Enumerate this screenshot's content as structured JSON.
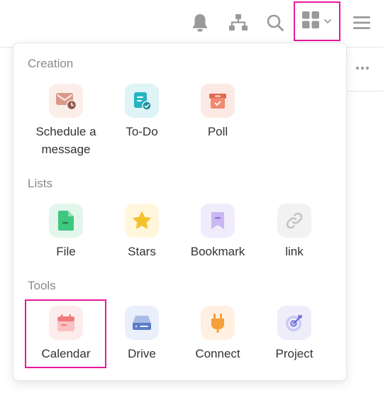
{
  "topbar": {
    "icons": [
      "bell-icon",
      "org-chart-icon",
      "search-icon",
      "apps-grid-icon",
      "chevron-down-icon",
      "hamburger-menu-icon"
    ]
  },
  "menu": {
    "sections": [
      {
        "title": "Creation",
        "items": [
          {
            "label": "Schedule a message",
            "icon": "schedule-message-icon",
            "bg": "#fbeee9",
            "color": "#d99a8a"
          },
          {
            "label": "To-Do",
            "icon": "todo-icon",
            "bg": "#def4f6",
            "color": "#27b3c1"
          },
          {
            "label": "Poll",
            "icon": "poll-icon",
            "bg": "#fde9e3",
            "color": "#f08a6e"
          }
        ]
      },
      {
        "title": "Lists",
        "items": [
          {
            "label": "File",
            "icon": "file-icon",
            "bg": "#e3f6ec",
            "color": "#3ec77e"
          },
          {
            "label": "Stars",
            "icon": "star-icon",
            "bg": "#fff6dc",
            "color": "#f5c12f"
          },
          {
            "label": "Bookmark",
            "icon": "bookmark-icon",
            "bg": "#f1ecfb",
            "color": "#b9a6ee"
          },
          {
            "label": "link",
            "icon": "link-icon",
            "bg": "#f2f2f2",
            "color": "#c4c4c4"
          }
        ]
      },
      {
        "title": "Tools",
        "items": [
          {
            "label": "Calendar",
            "icon": "calendar-icon",
            "bg": "#fdecec",
            "color": "#f07a7a"
          },
          {
            "label": "Drive",
            "icon": "drive-icon",
            "bg": "#e9effb",
            "color": "#5a7bc7"
          },
          {
            "label": "Connect",
            "icon": "plug-icon",
            "bg": "#fff0e1",
            "color": "#f5a03a"
          },
          {
            "label": "Project",
            "icon": "target-icon",
            "bg": "#eeeefb",
            "color": "#8c8ce8"
          }
        ]
      }
    ]
  },
  "colors": {
    "highlight": "#e6199b",
    "icon_gray": "#9a9a9a"
  }
}
